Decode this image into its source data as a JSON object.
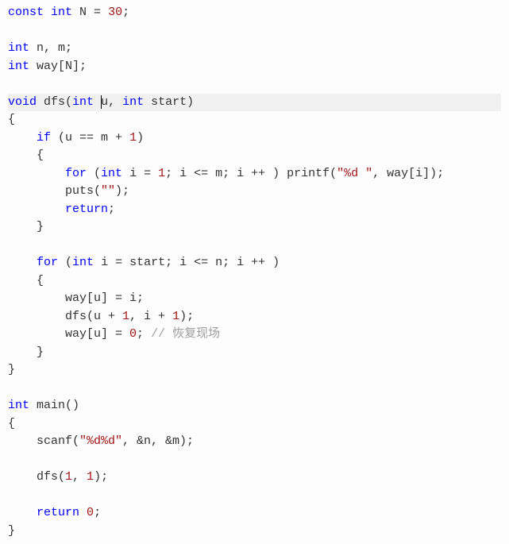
{
  "code": {
    "lines": [
      {
        "hl": false,
        "tokens": [
          {
            "cls": "kw",
            "t": "const"
          },
          {
            "cls": "txt",
            "t": " "
          },
          {
            "cls": "kw",
            "t": "int"
          },
          {
            "cls": "txt",
            "t": " N = "
          },
          {
            "cls": "num",
            "t": "30"
          },
          {
            "cls": "txt",
            "t": ";"
          }
        ]
      },
      {
        "hl": false,
        "tokens": []
      },
      {
        "hl": false,
        "tokens": [
          {
            "cls": "kw",
            "t": "int"
          },
          {
            "cls": "txt",
            "t": " n, m;"
          }
        ]
      },
      {
        "hl": false,
        "tokens": [
          {
            "cls": "kw",
            "t": "int"
          },
          {
            "cls": "txt",
            "t": " way[N];"
          }
        ]
      },
      {
        "hl": false,
        "tokens": []
      },
      {
        "hl": true,
        "tokens": [
          {
            "cls": "kw",
            "t": "void"
          },
          {
            "cls": "txt",
            "t": " dfs("
          },
          {
            "cls": "kw",
            "t": "int"
          },
          {
            "cls": "txt",
            "t": " "
          },
          {
            "cls": "cursor",
            "t": ""
          },
          {
            "cls": "txt",
            "t": "u, "
          },
          {
            "cls": "kw",
            "t": "int"
          },
          {
            "cls": "txt",
            "t": " start)"
          }
        ]
      },
      {
        "hl": false,
        "tokens": [
          {
            "cls": "txt",
            "t": "{"
          }
        ]
      },
      {
        "hl": false,
        "tokens": [
          {
            "cls": "txt",
            "t": "    "
          },
          {
            "cls": "kw",
            "t": "if"
          },
          {
            "cls": "txt",
            "t": " (u == m + "
          },
          {
            "cls": "num",
            "t": "1"
          },
          {
            "cls": "txt",
            "t": ")"
          }
        ]
      },
      {
        "hl": false,
        "tokens": [
          {
            "cls": "txt",
            "t": "    {"
          }
        ]
      },
      {
        "hl": false,
        "tokens": [
          {
            "cls": "txt",
            "t": "        "
          },
          {
            "cls": "kw",
            "t": "for"
          },
          {
            "cls": "txt",
            "t": " ("
          },
          {
            "cls": "kw",
            "t": "int"
          },
          {
            "cls": "txt",
            "t": " i = "
          },
          {
            "cls": "num",
            "t": "1"
          },
          {
            "cls": "txt",
            "t": "; i <= m; i ++ ) printf("
          },
          {
            "cls": "str",
            "t": "\"%d \""
          },
          {
            "cls": "txt",
            "t": ", way[i]);"
          }
        ]
      },
      {
        "hl": false,
        "tokens": [
          {
            "cls": "txt",
            "t": "        puts("
          },
          {
            "cls": "str",
            "t": "\"\""
          },
          {
            "cls": "txt",
            "t": ");"
          }
        ]
      },
      {
        "hl": false,
        "tokens": [
          {
            "cls": "txt",
            "t": "        "
          },
          {
            "cls": "kw",
            "t": "return"
          },
          {
            "cls": "txt",
            "t": ";"
          }
        ]
      },
      {
        "hl": false,
        "tokens": [
          {
            "cls": "txt",
            "t": "    }"
          }
        ]
      },
      {
        "hl": false,
        "tokens": []
      },
      {
        "hl": false,
        "tokens": [
          {
            "cls": "txt",
            "t": "    "
          },
          {
            "cls": "kw",
            "t": "for"
          },
          {
            "cls": "txt",
            "t": " ("
          },
          {
            "cls": "kw",
            "t": "int"
          },
          {
            "cls": "txt",
            "t": " i = start; i <= n; i ++ )"
          }
        ]
      },
      {
        "hl": false,
        "tokens": [
          {
            "cls": "txt",
            "t": "    {"
          }
        ]
      },
      {
        "hl": false,
        "tokens": [
          {
            "cls": "txt",
            "t": "        way[u] = i;"
          }
        ]
      },
      {
        "hl": false,
        "tokens": [
          {
            "cls": "txt",
            "t": "        dfs(u + "
          },
          {
            "cls": "num",
            "t": "1"
          },
          {
            "cls": "txt",
            "t": ", i + "
          },
          {
            "cls": "num",
            "t": "1"
          },
          {
            "cls": "txt",
            "t": ");"
          }
        ]
      },
      {
        "hl": false,
        "tokens": [
          {
            "cls": "txt",
            "t": "        way[u] = "
          },
          {
            "cls": "num",
            "t": "0"
          },
          {
            "cls": "txt",
            "t": "; "
          },
          {
            "cls": "com",
            "t": "// 恢复现场"
          }
        ]
      },
      {
        "hl": false,
        "tokens": [
          {
            "cls": "txt",
            "t": "    }"
          }
        ]
      },
      {
        "hl": false,
        "tokens": [
          {
            "cls": "txt",
            "t": "}"
          }
        ]
      },
      {
        "hl": false,
        "tokens": []
      },
      {
        "hl": false,
        "tokens": [
          {
            "cls": "kw",
            "t": "int"
          },
          {
            "cls": "txt",
            "t": " main()"
          }
        ]
      },
      {
        "hl": false,
        "tokens": [
          {
            "cls": "txt",
            "t": "{"
          }
        ]
      },
      {
        "hl": false,
        "tokens": [
          {
            "cls": "txt",
            "t": "    scanf("
          },
          {
            "cls": "str",
            "t": "\"%d%d\""
          },
          {
            "cls": "txt",
            "t": ", &n, &m);"
          }
        ]
      },
      {
        "hl": false,
        "tokens": []
      },
      {
        "hl": false,
        "tokens": [
          {
            "cls": "txt",
            "t": "    dfs("
          },
          {
            "cls": "num",
            "t": "1"
          },
          {
            "cls": "txt",
            "t": ", "
          },
          {
            "cls": "num",
            "t": "1"
          },
          {
            "cls": "txt",
            "t": ");"
          }
        ]
      },
      {
        "hl": false,
        "tokens": []
      },
      {
        "hl": false,
        "tokens": [
          {
            "cls": "txt",
            "t": "    "
          },
          {
            "cls": "kw",
            "t": "return"
          },
          {
            "cls": "txt",
            "t": " "
          },
          {
            "cls": "num",
            "t": "0"
          },
          {
            "cls": "txt",
            "t": ";"
          }
        ]
      },
      {
        "hl": false,
        "tokens": [
          {
            "cls": "txt",
            "t": "}"
          }
        ]
      }
    ]
  }
}
